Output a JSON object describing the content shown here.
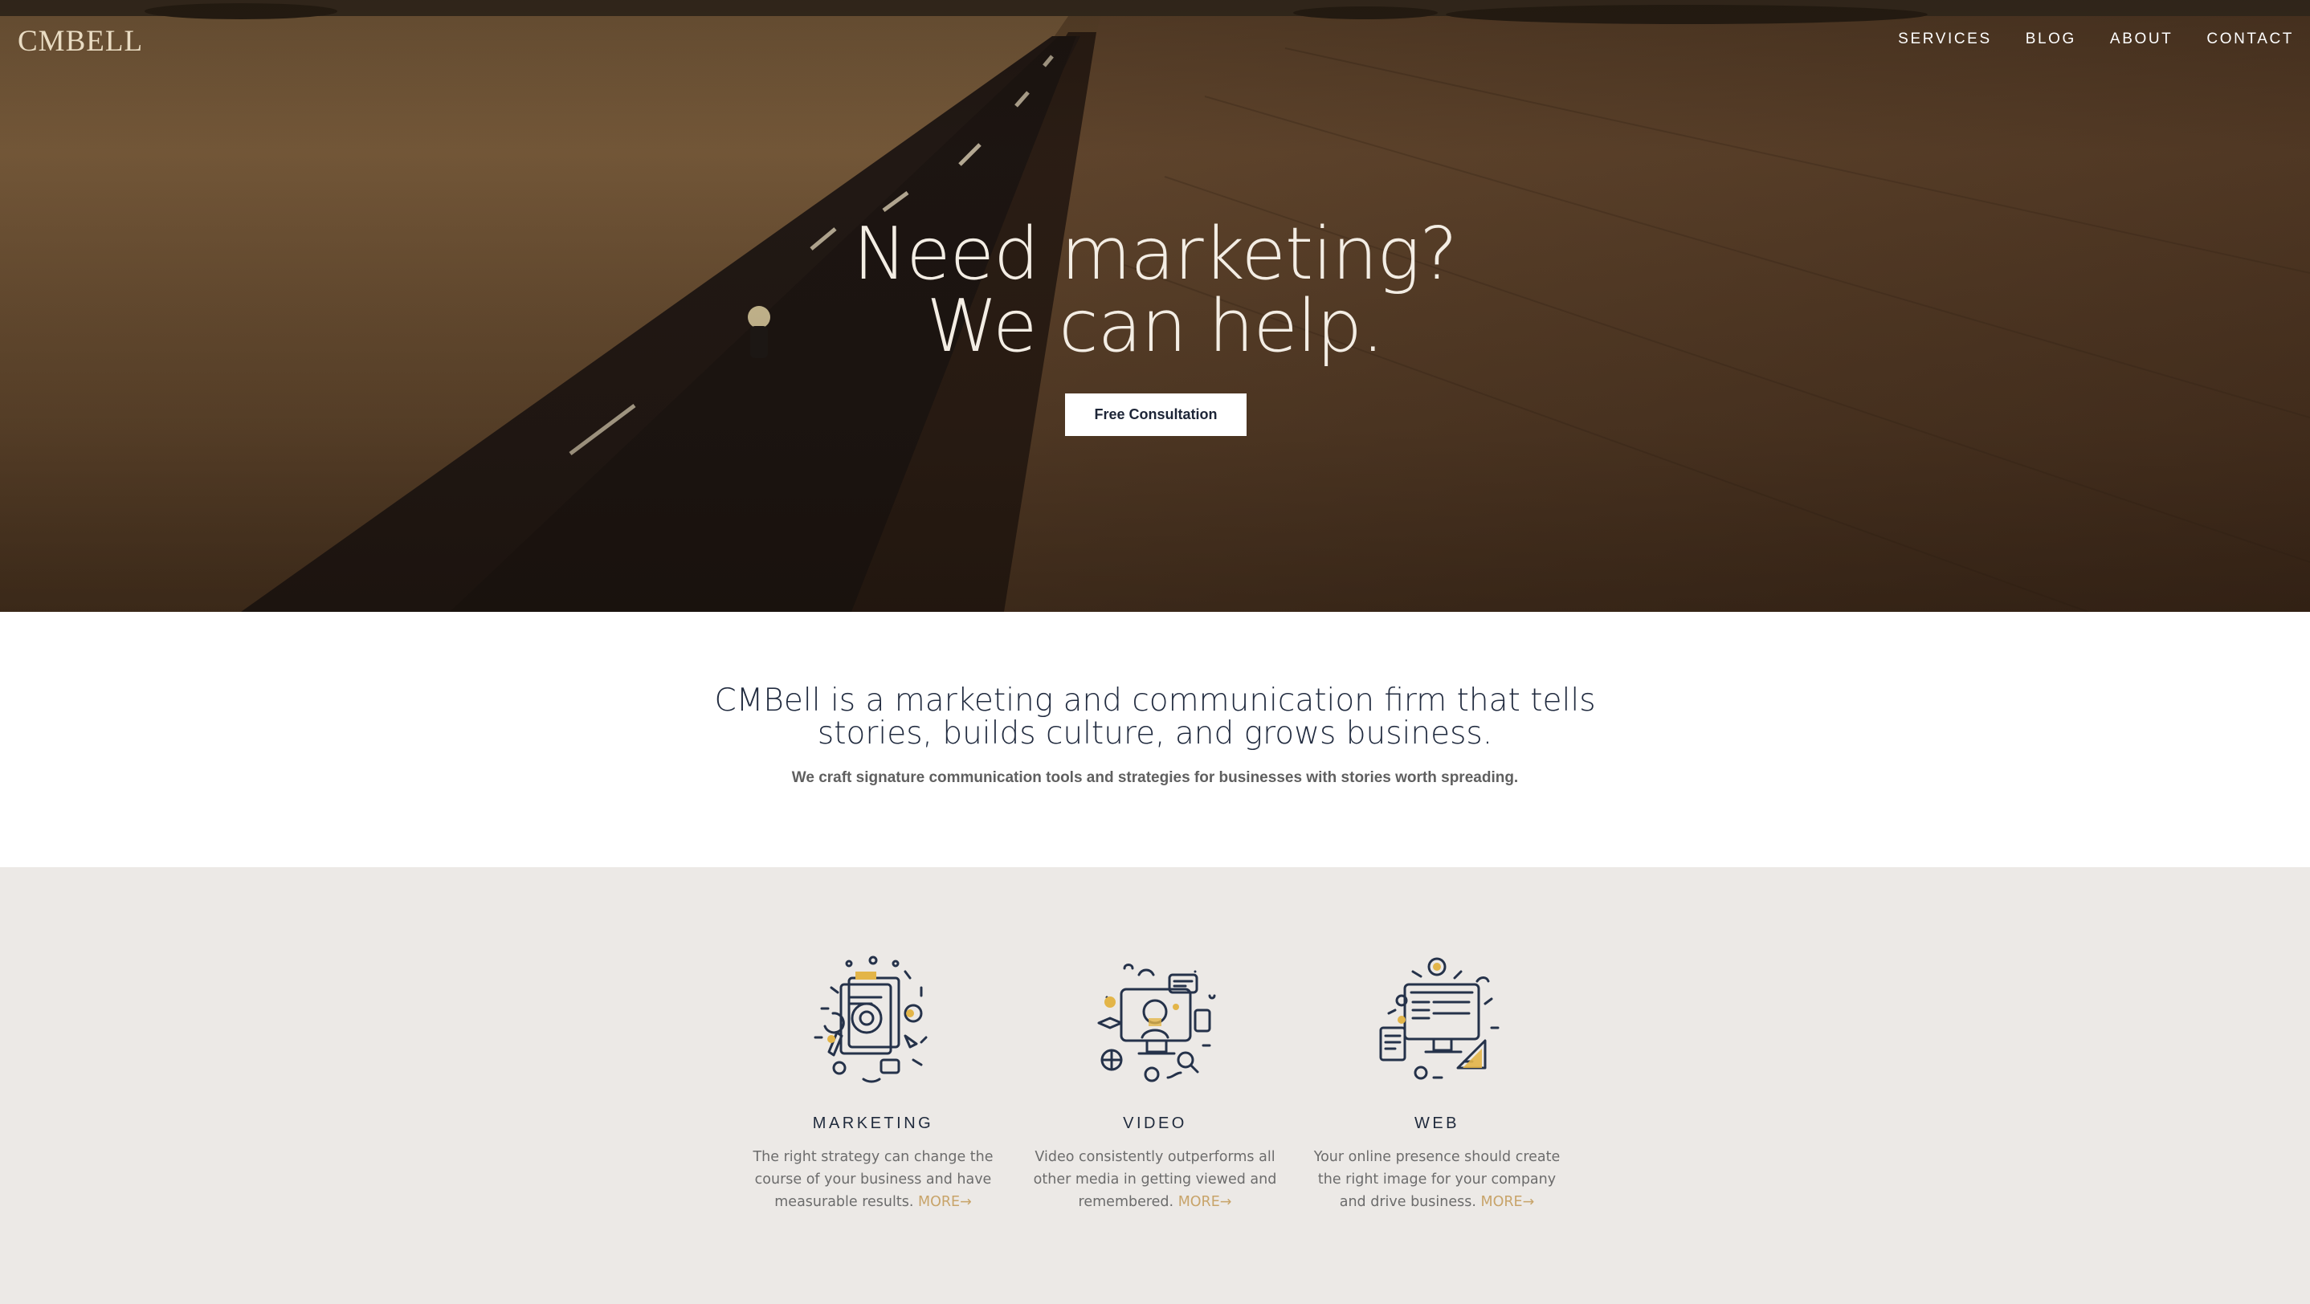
{
  "brand": {
    "logo_text": "CMBELL"
  },
  "nav": {
    "items": [
      "SERVICES",
      "BLOG",
      "ABOUT",
      "CONTACT"
    ]
  },
  "hero": {
    "headline_line1": "Need marketing?",
    "headline_line2": "We can help.",
    "cta_label": "Free Consultation"
  },
  "intro": {
    "heading_line1": "CMBell is a marketing and communication firm that tells",
    "heading_line2": "stories, builds culture, and grows business.",
    "subheading": "We craft signature communication tools and strategies for businesses with stories worth spreading."
  },
  "services": [
    {
      "title": "MARKETING",
      "description": "The right strategy can change the course of your business and have measurable results.",
      "more_label": "MORE→",
      "icon": "marketing-illustration-icon"
    },
    {
      "title": "VIDEO",
      "description": "Video consistently outperforms all other media in getting viewed and remembered.",
      "more_label": "MORE→",
      "icon": "video-illustration-icon"
    },
    {
      "title": "WEB",
      "description": "Your online presence should create the right image for your company and drive business.",
      "more_label": "MORE→",
      "icon": "web-illustration-icon"
    }
  ],
  "colors": {
    "accent_gold": "#c8a46a",
    "navy": "#1f2a3c",
    "services_bg": "#ece9e6"
  }
}
